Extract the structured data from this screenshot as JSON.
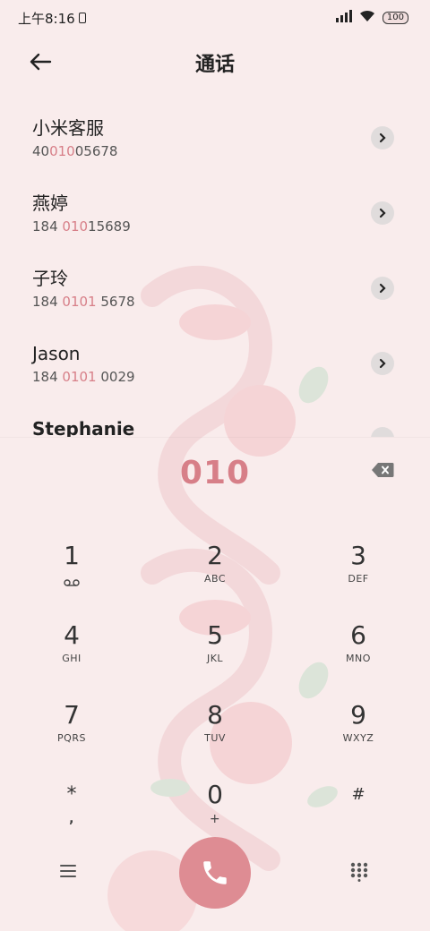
{
  "status": {
    "time": "上午8:16",
    "battery": "100"
  },
  "header": {
    "title": "通话"
  },
  "contacts": [
    {
      "name": "小米客服",
      "num_pre": "40",
      "num_hl": "010",
      "num_post": "05678"
    },
    {
      "name": "燕婷",
      "num_pre": "184 ",
      "num_hl": "010",
      "num_post": "15689"
    },
    {
      "name": "子玲",
      "num_pre": "184 ",
      "num_hl": "0101",
      "num_post": " 5678"
    },
    {
      "name": "Jason",
      "num_pre": "184 ",
      "num_hl": "0101",
      "num_post": " 0029"
    },
    {
      "name": "Stephanie",
      "num_pre": "",
      "num_hl": "",
      "num_post": ""
    }
  ],
  "dialer": {
    "number": "010"
  },
  "keypad": [
    {
      "digit": "1",
      "letters": ""
    },
    {
      "digit": "2",
      "letters": "ABC"
    },
    {
      "digit": "3",
      "letters": "DEF"
    },
    {
      "digit": "4",
      "letters": "GHI"
    },
    {
      "digit": "5",
      "letters": "JKL"
    },
    {
      "digit": "6",
      "letters": "MNO"
    },
    {
      "digit": "7",
      "letters": "PQRS"
    },
    {
      "digit": "8",
      "letters": "TUV"
    },
    {
      "digit": "9",
      "letters": "WXYZ"
    },
    {
      "digit": "*",
      "letters": ","
    },
    {
      "digit": "0",
      "letters": "+"
    },
    {
      "digit": "#",
      "letters": ""
    }
  ],
  "icons": {
    "back": "back-arrow-icon",
    "voicemail": "voicemail-icon",
    "backspace": "backspace-icon",
    "menu": "menu-icon",
    "call": "phone-icon",
    "keypad": "dialpad-icon"
  },
  "colors": {
    "accent": "#d77f88",
    "call_button": "#de8c93",
    "background": "#f9ecec"
  }
}
